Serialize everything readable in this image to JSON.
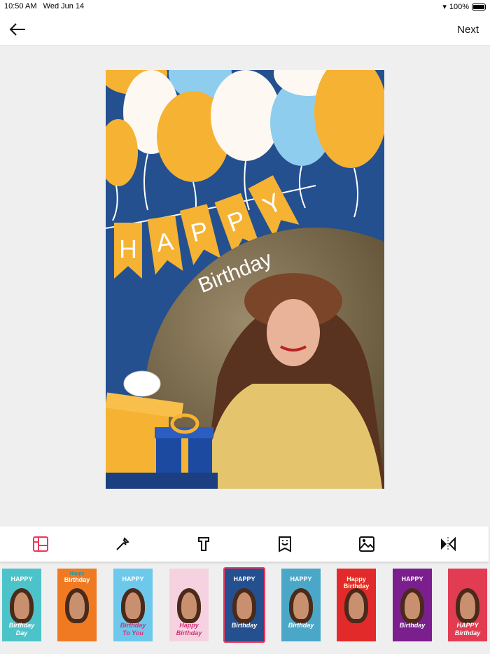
{
  "status_bar": {
    "time": "10:50 AM",
    "date": "Wed Jun 14",
    "battery": "100%"
  },
  "nav": {
    "next_label": "Next"
  },
  "card": {
    "banner_letters": [
      "H",
      "A",
      "P",
      "P",
      "Y"
    ],
    "subtitle": "Birthday"
  },
  "toolbar": {
    "tools": [
      {
        "name": "layout-icon",
        "active": true
      },
      {
        "name": "color-picker-icon"
      },
      {
        "name": "text-icon"
      },
      {
        "name": "sticker-icon"
      },
      {
        "name": "image-icon"
      },
      {
        "name": "flip-icon"
      }
    ]
  },
  "templates": [
    {
      "top": "HAPPY",
      "bottom": "Birthday",
      "extra": "Day",
      "bg": "#4cc3c9"
    },
    {
      "top": "Birthday",
      "pre": "Happy",
      "bg": "#f07a22"
    },
    {
      "top": "HAPPY",
      "bottom": "Birthday",
      "extra": "To You",
      "bg": "#6cc9ec"
    },
    {
      "top": "",
      "bottom": "Happy",
      "extra": "Birthday",
      "bg": "#f6d2e0"
    },
    {
      "top": "HAPPY",
      "bottom": "Birthday",
      "bg": "#24508f",
      "selected": true
    },
    {
      "top": "HAPPY",
      "bottom": "Birthday",
      "bg": "#4aa7c8"
    },
    {
      "top": "Happy Birthday",
      "bg": "#e32a2a"
    },
    {
      "top": "HAPPY",
      "bottom": "Birthday",
      "bg": "#7b1f8e"
    },
    {
      "top": "",
      "bottom": "HAPPY",
      "extra": "Birthday",
      "bg": "#e23c52"
    }
  ],
  "colors": {
    "accent": "#f0365a",
    "card_blue": "#24508f",
    "balloon_orange": "#f6b233",
    "balloon_blue": "#8fcdee"
  }
}
